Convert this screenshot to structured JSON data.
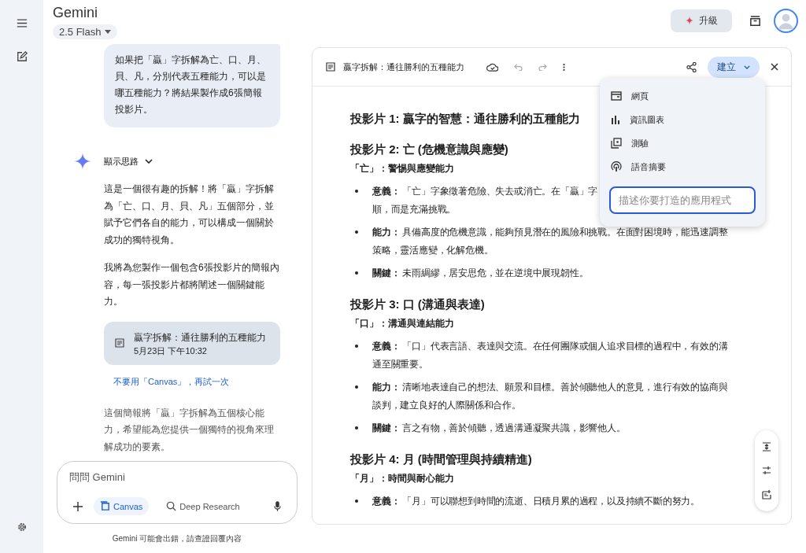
{
  "app": {
    "title": "Gemini",
    "model": "2.5 Flash",
    "upgrade": "升級"
  },
  "chat": {
    "user_message": "如果把「贏」字拆解為亡、口、月、貝、凡，分別代表五種能力，可以是哪五種能力？將結果製作成6張簡報投影片。",
    "thinking": "顯示思路",
    "paragraphs": [
      "這是一個很有趣的拆解！將「贏」字拆解為「亡、口、月、貝、凡」五個部分，並賦予它們各自的能力，可以構成一個關於成功的獨特視角。",
      "我將為您製作一個包含6張投影片的簡報內容，每一張投影片都將闡述一個關鍵能力。"
    ],
    "doc_card": {
      "title": "贏字拆解：通往勝利的五種能力",
      "date": "5月23日 下午10:32"
    },
    "retry_link": "不要用「Canvas」，再試一次",
    "closing": "這個簡報將「贏」字拆解為五個核心能力，希望能為您提供一個獨特的視角來理解成功的要素。"
  },
  "composer": {
    "placeholder": "問問 Gemini",
    "tools": [
      {
        "label": "Canvas",
        "selected": true
      },
      {
        "label": "Deep Research",
        "selected": false
      }
    ]
  },
  "disclaimer": "Gemini 可能會出錯，請查證回覆內容",
  "canvas": {
    "title": "贏字拆解：通往勝利的五種能力",
    "create_button": "建立",
    "sections": [
      {
        "heading": "投影片 1: 贏字的智慧：通往勝利的五種能力"
      },
      {
        "heading": "投影片 2: 亡 (危機意識與應變)",
        "subheading": "「亡」：警惕與應變能力",
        "bullets": [
          {
            "lines": [
              "**意義：** 「亡」字象徵著危險、失去或消亡。在「贏」字",
              "順，而是充滿挑戰。"
            ]
          },
          {
            "lines": [
              "**能力：** 具備高度的危機意識，能夠預見潛在的風險和挑戰。在面對困境時，能迅速調整策略，靈活應變，化解危機。"
            ]
          },
          {
            "lines": [
              "**關鍵：** 未雨綢繆，居安思危，並在逆境中展現韌性。"
            ]
          }
        ]
      },
      {
        "heading": "投影片 3: 口 (溝通與表達)",
        "subheading": "「口」：溝通與連結能力",
        "bullets": [
          {
            "lines": [
              "**意義：** 「口」代表言語、表達與交流。在任何團隊或個人追求目標的過程中，有效的溝通至關重要。"
            ]
          },
          {
            "lines": [
              "**能力：** 清晰地表達自己的想法、願景和目標。善於傾聽他人的意見，進行有效的協商與談判，建立良好的人際關係和合作。"
            ]
          },
          {
            "lines": [
              "**關鍵：** 言之有物，善於傾聽，透過溝通凝聚共識，影響他人。"
            ]
          }
        ]
      },
      {
        "heading": "投影片 4: 月 (時間管理與持續精進)",
        "subheading": "「月」：時間與耐心能力",
        "bullets": [
          {
            "lines": [
              "**意義：** 「月」可以聯想到時間的流逝、日積月累的過程，以及持續不斷的努力。"
            ]
          }
        ]
      }
    ],
    "menu": {
      "items": [
        {
          "kind": "webpage",
          "label": "網頁"
        },
        {
          "kind": "infographic",
          "label": "資訊圖表"
        },
        {
          "kind": "quiz",
          "label": "測驗"
        },
        {
          "kind": "audio",
          "label": "語音摘要"
        }
      ],
      "placeholder": "描述你要打造的應用程式"
    }
  }
}
